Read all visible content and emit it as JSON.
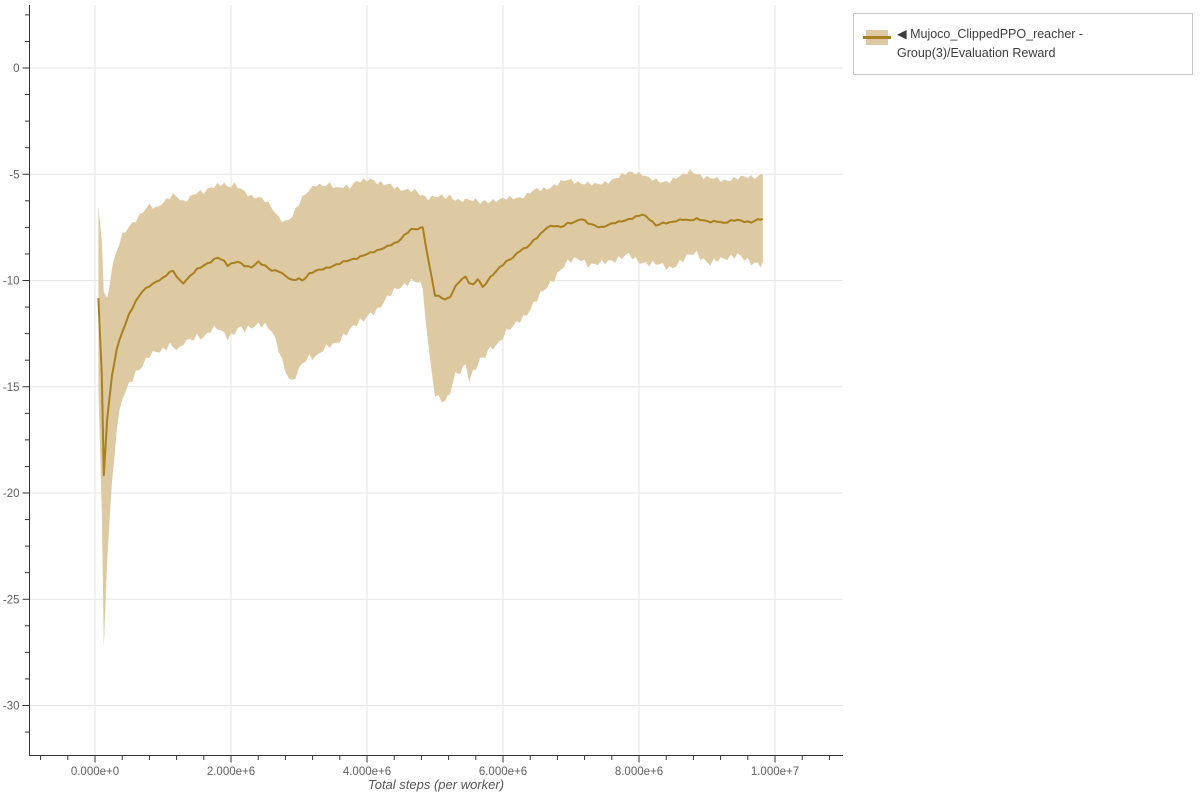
{
  "page": {
    "background": "#ffffff"
  },
  "colors": {
    "line": "#aa801e",
    "band": "#ddcaa2",
    "grid": "#e6e6e6",
    "axis": "#333333",
    "tick_label": "#5f5f5f",
    "axis_title": "#555555",
    "legend_border": "#c9c9c9"
  },
  "legend": {
    "position": "top-right",
    "entries": [
      {
        "label": "◀ Mujoco_ClippedPPO_reacher - Group(3)/Evaluation Reward",
        "swatch_fill": "#ddcaa2",
        "swatch_line": "#aa801e"
      }
    ]
  },
  "chart_data": {
    "type": "line",
    "title": "",
    "xlabel": "Total steps (per worker)",
    "ylabel": "",
    "grid": "on",
    "legend_position": "top-right",
    "x_unit": "steps",
    "xlim_millions": [
      -1.0,
      11.0
    ],
    "ylim": [
      -32.3,
      3.0
    ],
    "x_tick_values_millions": [
      0,
      2,
      4,
      6,
      8,
      10
    ],
    "x_tick_labels": [
      "0.000e+0",
      "2.000e+6",
      "4.000e+6",
      "6.000e+6",
      "8.000e+6",
      "1.000e+7"
    ],
    "x_minor_step_millions": 0.4,
    "x_minor_range_millions": [
      -0.8,
      10.8
    ],
    "y_tick_values": [
      0,
      -5,
      -10,
      -15,
      -20,
      -25,
      -30
    ],
    "y_tick_labels": [
      "0",
      "-5",
      "-10",
      "-15",
      "-20",
      "-25",
      "-30"
    ],
    "y_minor_step": 1.25,
    "y_minor_range": [
      2.5,
      -31.25
    ],
    "series": [
      {
        "name": "Mujoco_ClippedPPO_reacher - Group(3)/Evaluation Reward",
        "color": "#aa801e",
        "band_color": "#ddcaa2",
        "x_millions": [
          0.05,
          0.1,
          0.13,
          0.18,
          0.25,
          0.32,
          0.4,
          0.5,
          0.6,
          0.7,
          0.8,
          0.9,
          1.0,
          1.1,
          1.15,
          1.25,
          1.3,
          1.4,
          1.5,
          1.6,
          1.7,
          1.8,
          1.9,
          1.95,
          2.05,
          2.1,
          2.2,
          2.3,
          2.4,
          2.5,
          2.6,
          2.7,
          2.8,
          2.9,
          3.0,
          3.05,
          3.15,
          3.25,
          3.35,
          3.45,
          3.55,
          3.65,
          3.75,
          3.85,
          3.95,
          4.05,
          4.15,
          4.25,
          4.35,
          4.45,
          4.55,
          4.65,
          4.75,
          4.82,
          4.9,
          5.0,
          5.1,
          5.15,
          5.22,
          5.3,
          5.37,
          5.45,
          5.5,
          5.56,
          5.63,
          5.7,
          5.78,
          5.85,
          5.95,
          6.05,
          6.15,
          6.25,
          6.35,
          6.45,
          6.55,
          6.65,
          6.75,
          6.85,
          6.95,
          7.05,
          7.15,
          7.25,
          7.35,
          7.45,
          7.55,
          7.65,
          7.75,
          7.85,
          7.95,
          8.05,
          8.15,
          8.25,
          8.35,
          8.45,
          8.55,
          8.65,
          8.75,
          8.85,
          8.95,
          9.05,
          9.15,
          9.25,
          9.35,
          9.45,
          9.55,
          9.65,
          9.75,
          9.82
        ],
        "mean": [
          -10.8,
          -14.5,
          -19.2,
          -16.5,
          -14.5,
          -13.2,
          -12.4,
          -11.6,
          -11.0,
          -10.5,
          -10.25,
          -10.05,
          -9.9,
          -9.6,
          -9.55,
          -10.0,
          -10.1,
          -9.8,
          -9.5,
          -9.3,
          -9.1,
          -8.9,
          -9.1,
          -9.3,
          -9.15,
          -9.1,
          -9.3,
          -9.4,
          -9.15,
          -9.3,
          -9.5,
          -9.55,
          -9.8,
          -10.0,
          -9.9,
          -10.0,
          -9.7,
          -9.55,
          -9.45,
          -9.35,
          -9.25,
          -9.15,
          -9.05,
          -8.95,
          -8.8,
          -8.7,
          -8.6,
          -8.45,
          -8.3,
          -8.2,
          -7.9,
          -7.6,
          -7.55,
          -7.5,
          -9.0,
          -10.7,
          -10.8,
          -10.9,
          -10.75,
          -10.3,
          -10.0,
          -9.85,
          -10.1,
          -10.2,
          -9.9,
          -10.3,
          -10.0,
          -9.75,
          -9.4,
          -9.1,
          -8.9,
          -8.6,
          -8.45,
          -8.1,
          -7.8,
          -7.5,
          -7.45,
          -7.5,
          -7.3,
          -7.25,
          -7.1,
          -7.3,
          -7.4,
          -7.5,
          -7.4,
          -7.3,
          -7.2,
          -7.1,
          -7.0,
          -6.9,
          -7.1,
          -7.4,
          -7.3,
          -7.3,
          -7.2,
          -7.1,
          -7.15,
          -7.1,
          -7.2,
          -7.25,
          -7.2,
          -7.3,
          -7.2,
          -7.15,
          -7.2,
          -7.25,
          -7.15,
          -7.1
        ],
        "band_lower": [
          -15.0,
          -21.0,
          -27.3,
          -23.0,
          -19.5,
          -17.0,
          -15.6,
          -14.9,
          -14.3,
          -14.0,
          -13.6,
          -13.4,
          -13.2,
          -12.9,
          -13.1,
          -13.3,
          -13.0,
          -12.8,
          -12.6,
          -12.7,
          -12.4,
          -12.2,
          -12.4,
          -12.6,
          -12.5,
          -12.3,
          -12.4,
          -12.2,
          -12.0,
          -12.1,
          -12.4,
          -13.2,
          -14.2,
          -14.8,
          -14.3,
          -14.0,
          -13.6,
          -13.5,
          -13.2,
          -13.1,
          -13.0,
          -12.6,
          -12.3,
          -12.1,
          -11.9,
          -11.5,
          -11.3,
          -11.0,
          -10.7,
          -10.4,
          -10.2,
          -10.0,
          -10.1,
          -10.5,
          -13.0,
          -15.3,
          -15.6,
          -15.8,
          -15.3,
          -14.5,
          -14.2,
          -13.9,
          -14.6,
          -14.3,
          -14.0,
          -13.7,
          -13.3,
          -13.1,
          -12.9,
          -12.5,
          -12.2,
          -11.8,
          -11.5,
          -11.1,
          -10.7,
          -10.3,
          -9.9,
          -9.5,
          -9.2,
          -9.0,
          -8.9,
          -9.2,
          -9.3,
          -9.25,
          -9.1,
          -9.0,
          -8.9,
          -8.8,
          -9.0,
          -9.1,
          -9.2,
          -9.3,
          -9.35,
          -9.4,
          -9.2,
          -9.0,
          -8.8,
          -8.7,
          -9.0,
          -9.25,
          -9.1,
          -9.0,
          -8.8,
          -8.7,
          -9.0,
          -9.25,
          -9.2,
          -9.15
        ],
        "band_upper": [
          -6.5,
          -8.0,
          -10.5,
          -10.8,
          -9.5,
          -8.6,
          -7.9,
          -7.4,
          -7.1,
          -6.8,
          -6.5,
          -6.6,
          -6.3,
          -6.1,
          -6.0,
          -6.2,
          -6.3,
          -6.0,
          -5.8,
          -5.9,
          -5.7,
          -5.5,
          -5.4,
          -5.6,
          -5.5,
          -5.6,
          -5.8,
          -6.0,
          -6.1,
          -6.3,
          -6.6,
          -7.0,
          -7.2,
          -7.0,
          -6.4,
          -6.1,
          -5.7,
          -5.5,
          -5.6,
          -5.5,
          -5.6,
          -5.5,
          -5.6,
          -5.4,
          -5.3,
          -5.2,
          -5.4,
          -5.5,
          -5.5,
          -5.6,
          -5.7,
          -5.8,
          -5.9,
          -6.0,
          -6.1,
          -6.0,
          -6.05,
          -6.1,
          -6.1,
          -6.15,
          -6.2,
          -6.2,
          -6.25,
          -6.3,
          -6.3,
          -6.3,
          -6.25,
          -6.2,
          -6.2,
          -6.15,
          -6.1,
          -6.1,
          -6.0,
          -5.8,
          -5.7,
          -5.6,
          -5.5,
          -5.4,
          -5.3,
          -5.35,
          -5.4,
          -5.45,
          -5.5,
          -5.4,
          -5.3,
          -5.2,
          -5.1,
          -4.95,
          -4.9,
          -4.95,
          -5.2,
          -5.3,
          -5.35,
          -5.3,
          -5.2,
          -5.1,
          -4.85,
          -4.9,
          -5.1,
          -5.2,
          -5.25,
          -5.3,
          -5.25,
          -5.2,
          -5.15,
          -5.1,
          -5.05,
          -5.0
        ]
      }
    ]
  }
}
